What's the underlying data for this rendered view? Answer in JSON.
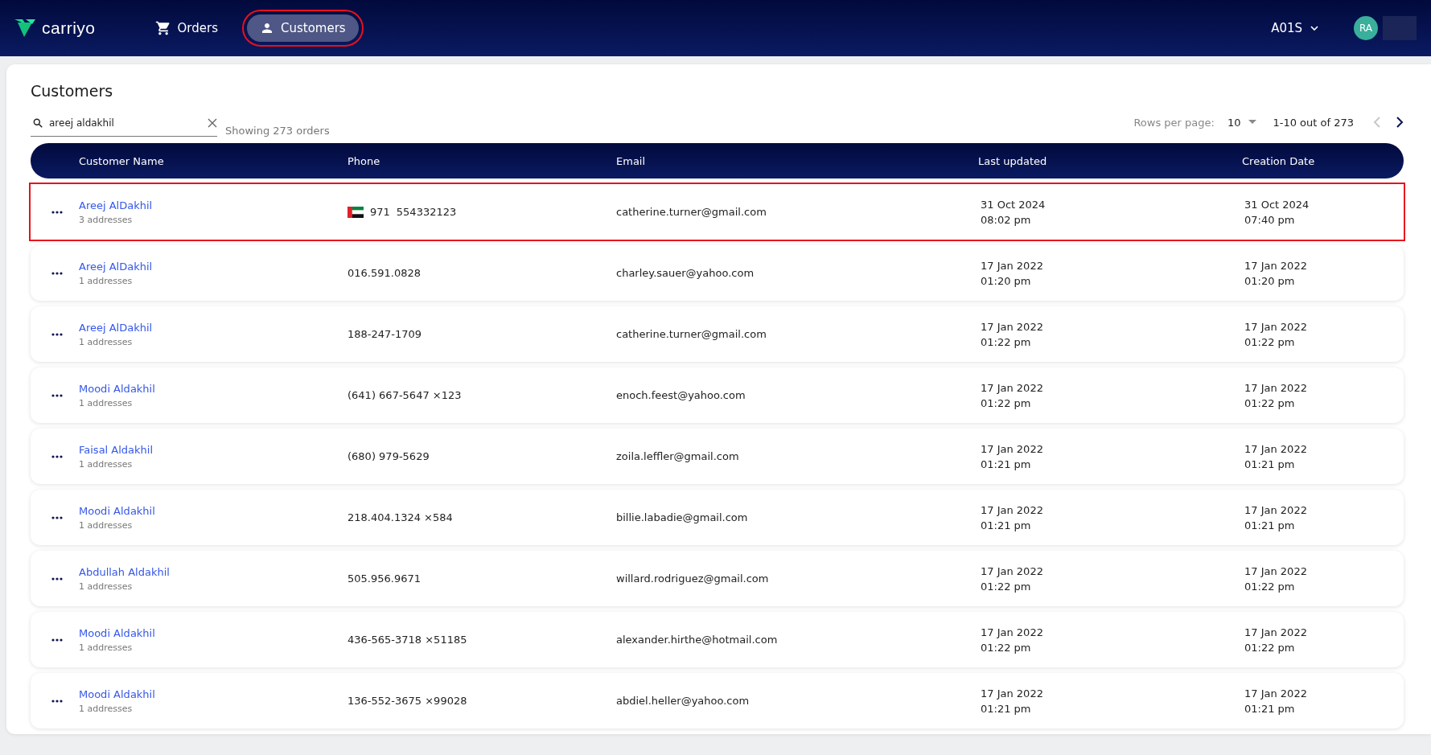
{
  "header": {
    "logo": "carriyo",
    "nav": [
      {
        "label": "Orders",
        "kind": "cart",
        "selected": false,
        "highlighted": false
      },
      {
        "label": "Customers",
        "kind": "person",
        "selected": true,
        "highlighted": true
      }
    ],
    "account": "A01S",
    "avatar": "RA"
  },
  "page": {
    "title": "Customers",
    "search": {
      "value": "areej aldakhil"
    },
    "result_count": "Showing 273 orders",
    "pagination": {
      "rows_label": "Rows per page:",
      "rows_value": "10",
      "range": "1-10 out of 273",
      "prev_disabled": true,
      "next_disabled": false
    }
  },
  "table": {
    "columns": [
      "Customer Name",
      "Phone",
      "Email",
      "Last updated",
      "Creation Date"
    ],
    "rows": [
      {
        "name": "Areej AlDakhil",
        "addresses": "3 addresses",
        "flag": true,
        "phone_code": "971",
        "phone": "554332123",
        "email": "catherine.turner@gmail.com",
        "updated_date": "31 Oct 2024",
        "updated_time": "08:02 pm",
        "created_date": "31 Oct 2024",
        "created_time": "07:40 pm",
        "highlighted": true
      },
      {
        "name": "Areej AlDakhil",
        "addresses": "1 addresses",
        "flag": false,
        "phone": "016.591.0828",
        "email": "charley.sauer@yahoo.com",
        "updated_date": "17 Jan 2022",
        "updated_time": "01:20 pm",
        "created_date": "17 Jan 2022",
        "created_time": "01:20 pm",
        "highlighted": false
      },
      {
        "name": "Areej AlDakhil",
        "addresses": "1 addresses",
        "flag": false,
        "phone": "188-247-1709",
        "email": "catherine.turner@gmail.com",
        "updated_date": "17 Jan 2022",
        "updated_time": "01:22 pm",
        "created_date": "17 Jan 2022",
        "created_time": "01:22 pm",
        "highlighted": false
      },
      {
        "name": "Moodi Aldakhil",
        "addresses": "1 addresses",
        "flag": false,
        "phone": "(641) 667-5647 ×123",
        "email": "enoch.feest@yahoo.com",
        "updated_date": "17 Jan 2022",
        "updated_time": "01:22 pm",
        "created_date": "17 Jan 2022",
        "created_time": "01:22 pm",
        "highlighted": false
      },
      {
        "name": "Faisal Aldakhil",
        "addresses": "1 addresses",
        "flag": false,
        "phone": "(680) 979-5629",
        "email": "zoila.leffler@gmail.com",
        "updated_date": "17 Jan 2022",
        "updated_time": "01:21 pm",
        "created_date": "17 Jan 2022",
        "created_time": "01:21 pm",
        "highlighted": false
      },
      {
        "name": "Moodi Aldakhil",
        "addresses": "1 addresses",
        "flag": false,
        "phone": "218.404.1324 ×584",
        "email": "billie.labadie@gmail.com",
        "updated_date": "17 Jan 2022",
        "updated_time": "01:21 pm",
        "created_date": "17 Jan 2022",
        "created_time": "01:21 pm",
        "highlighted": false
      },
      {
        "name": "Abdullah Aldakhil",
        "addresses": "1 addresses",
        "flag": false,
        "phone": "505.956.9671",
        "email": "willard.rodriguez@gmail.com",
        "updated_date": "17 Jan 2022",
        "updated_time": "01:22 pm",
        "created_date": "17 Jan 2022",
        "created_time": "01:22 pm",
        "highlighted": false
      },
      {
        "name": "Moodi Aldakhil",
        "addresses": "1 addresses",
        "flag": false,
        "phone": "436-565-3718 ×51185",
        "email": "alexander.hirthe@hotmail.com",
        "updated_date": "17 Jan 2022",
        "updated_time": "01:22 pm",
        "created_date": "17 Jan 2022",
        "created_time": "01:22 pm",
        "highlighted": false
      },
      {
        "name": "Moodi Aldakhil",
        "addresses": "1 addresses",
        "flag": false,
        "phone": "136-552-3675 ×99028",
        "email": "abdiel.heller@yahoo.com",
        "updated_date": "17 Jan 2022",
        "updated_time": "01:21 pm",
        "created_date": "17 Jan 2022",
        "created_time": "01:21 pm",
        "highlighted": false
      }
    ]
  }
}
